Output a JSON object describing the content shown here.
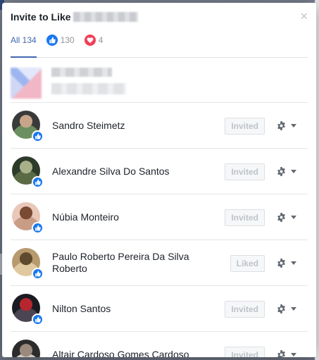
{
  "modal": {
    "title": "Invite to Like",
    "close_glyph": "×"
  },
  "tabs": [
    {
      "label": "All 134",
      "icon": "none",
      "active": true
    },
    {
      "label": "130",
      "icon": "like-icon",
      "active": false
    },
    {
      "label": "4",
      "icon": "love-icon",
      "active": false
    }
  ],
  "people": [
    {
      "name": "Sandro Steimetz",
      "status": "Invited",
      "avatar_colors": [
        "#3a3a3a",
        "#c7a58a",
        "#6b8f5e"
      ]
    },
    {
      "name": "Alexandre Silva Do Santos",
      "status": "Invited",
      "avatar_colors": [
        "#2d3b2a",
        "#a8b08a",
        "#5a6a44"
      ]
    },
    {
      "name": "Núbia Monteiro",
      "status": "Invited",
      "avatar_colors": [
        "#e9c7b9",
        "#7a4a33",
        "#c99c86"
      ]
    },
    {
      "name": "Paulo Roberto Pereira Da Silva Roberto",
      "status": "Liked",
      "avatar_colors": [
        "#b79a6e",
        "#5f4a2f",
        "#e0c9a0"
      ]
    },
    {
      "name": "Nilton Santos",
      "status": "Invited",
      "avatar_colors": [
        "#1a1a22",
        "#b7262e",
        "#4b4452"
      ]
    },
    {
      "name": "Altair Cardoso Gomes Cardoso",
      "status": "Invited",
      "avatar_colors": [
        "#2c2c2c",
        "#9a8a7c",
        "#d5cbc2"
      ]
    }
  ],
  "colors": {
    "accent": "#4267b2",
    "like": "#1877f2",
    "love": "#f33e58"
  }
}
